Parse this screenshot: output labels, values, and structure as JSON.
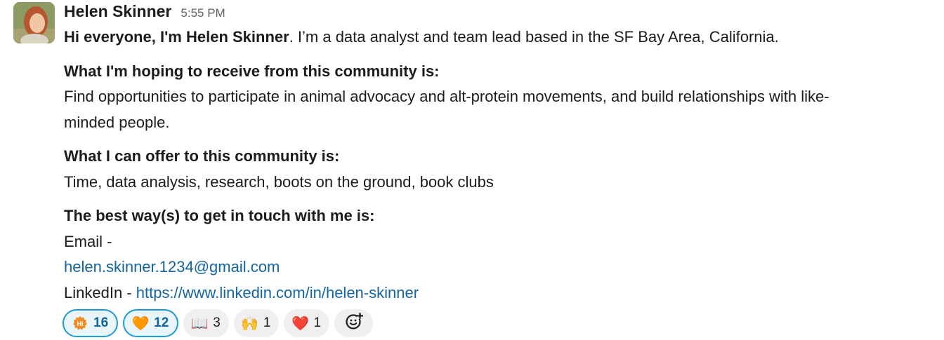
{
  "message": {
    "sender": "Helen Skinner",
    "time": "5:55 PM",
    "intro_bold": "Hi everyone, I'm Helen Skinner",
    "intro_rest": ". I’m a data analyst and team lead based in the SF Bay Area, California.",
    "sections": [
      {
        "title": "What I'm hoping to receive from this community is:",
        "body": "Find opportunities to participate in animal advocacy and alt-protein movements, and build relationships with like-",
        "body2": "minded people."
      },
      {
        "title": "What I can offer to this community is:",
        "body": "Time, data analysis, research, boots on the ground, book clubs"
      },
      {
        "title": "The best way(s) to get in touch with me is:",
        "email_label": "Email -",
        "email": "helen.skinner.1234@gmail.com",
        "linkedin_label": "LinkedIn - ",
        "linkedin_url": "https://www.linkedin.com/in/helen-skinner"
      }
    ]
  },
  "reactions": [
    {
      "emoji": "hi-icon",
      "count": "16",
      "active": true
    },
    {
      "emoji": "orange-heart",
      "glyph": "🧡",
      "count": "12",
      "active": true
    },
    {
      "emoji": "open-book",
      "glyph": "📖",
      "count": "3",
      "active": false
    },
    {
      "emoji": "raised-hands",
      "glyph": "🙌",
      "count": "1",
      "active": false
    },
    {
      "emoji": "red-heart",
      "glyph": "❤️",
      "count": "1",
      "active": false
    }
  ],
  "colors": {
    "link": "#1264a3",
    "active_reaction_border": "#1d9bd1",
    "active_reaction_bg": "#e8f5fa",
    "reaction_bg": "#efefef"
  }
}
